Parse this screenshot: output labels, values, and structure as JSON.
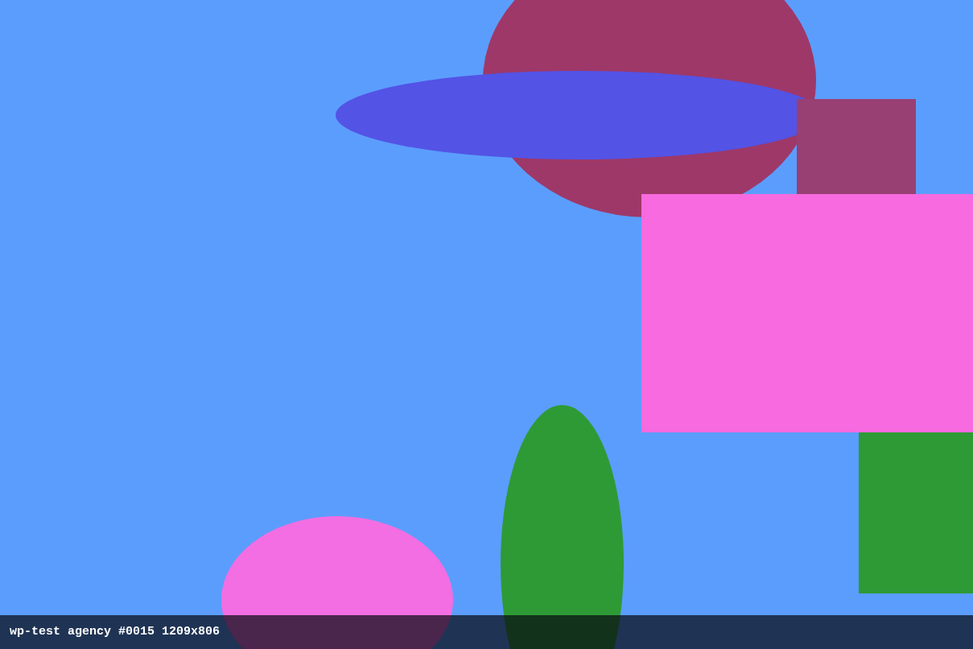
{
  "canvas": {
    "shapes": [
      {
        "kind": "ellipse",
        "color": "#9e3869"
      },
      {
        "kind": "ellipse",
        "color": "#5353e5"
      },
      {
        "kind": "rectangle",
        "color": "#983f74"
      },
      {
        "kind": "rectangle",
        "color": "#f86adf"
      },
      {
        "kind": "rectangle",
        "color": "#2e9a36"
      },
      {
        "kind": "ellipse",
        "color": "#2e9a36"
      },
      {
        "kind": "ellipse",
        "color": "#f26ee2"
      }
    ]
  },
  "caption": "wp-test agency #0015 1209x806"
}
